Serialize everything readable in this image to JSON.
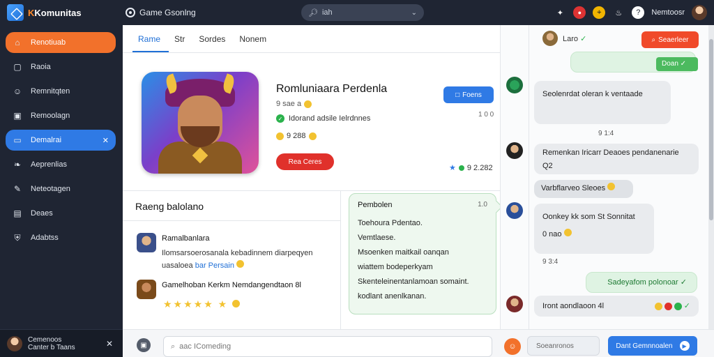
{
  "app": {
    "brand_prefix": "K",
    "brand_name": "Komunitas",
    "title": "Game Gsonlng"
  },
  "search": {
    "placeholder": "iah"
  },
  "top_user": "Nemtoosr",
  "sidebar": {
    "items": [
      {
        "label": "Renotiuab",
        "icon": "home-icon"
      },
      {
        "label": "Raoia",
        "icon": "card-icon"
      },
      {
        "label": "Remnitqten",
        "icon": "users-icon"
      },
      {
        "label": "Remoolagn",
        "icon": "image-icon"
      },
      {
        "label": "Demalrai",
        "icon": "chat-icon"
      },
      {
        "label": "Aeprenlias",
        "icon": "leaf-icon"
      },
      {
        "label": "Neteotagen",
        "icon": "pen-icon"
      },
      {
        "label": "Deaes",
        "icon": "book-icon"
      },
      {
        "label": "Adabtss",
        "icon": "shield-icon"
      }
    ],
    "footer": {
      "line1": "Cemenoos",
      "line2": "Canter b Taans"
    }
  },
  "tabs": [
    "Rame",
    "Str",
    "Sordes",
    "Nonem"
  ],
  "game": {
    "title": "Romluniaara Perdenla",
    "subtitle": "9 sae a",
    "verified": "Idorand adsile Ielrdnnes",
    "coins": "9 288",
    "button": "Rea Ceres",
    "time": "1 0 0",
    "follow": "Foens",
    "rating": "9 2.282"
  },
  "reviews": {
    "header": "Raeng balolano",
    "items": [
      {
        "name": "Ramalbanlara",
        "line1": "Ilomsarsoerosanala kebadinnem diarpeqyen",
        "line2_text": "uasaloea",
        "line2_link": "bar Persain"
      },
      {
        "name": "Gamelhoban",
        "line1": "Kerkm Nemdangendtaon 8l"
      }
    ]
  },
  "note": {
    "title": "Pembolen",
    "time": "1.0",
    "lines": [
      "Toehoura Pdentao.",
      "Vemtlaese.",
      "Msoenken maitkail oanqan",
      "wiattem bodeperkyam",
      "Skenteleinentanlamoan somaint.",
      "kodlant anenlkanan."
    ]
  },
  "chat": {
    "header_name": "Laro",
    "search_button": "Seaerleer",
    "messages": [
      {
        "dir": "out",
        "text": "Doan"
      },
      {
        "dir": "in",
        "text": "Seolenrdat oleran k ventaade",
        "meta": "9 1:4"
      },
      {
        "dir": "in",
        "text": "Remenkan Iricarr Deaoes pendanenarie Q2"
      },
      {
        "dir": "in",
        "text": "Varbflarveo Sleoes"
      },
      {
        "dir": "in",
        "text": "Oonkey kk som St Sonnitat",
        "sub": "0 nao",
        "meta": "9 3:4"
      },
      {
        "dir": "out",
        "text": "Sadeyafom polonoar"
      },
      {
        "dir": "in",
        "text": "Iront aondlaoon 4l"
      }
    ]
  },
  "composer": {
    "placeholder": "aac IComeding",
    "search": "Soeanronos",
    "send": "Dant Gemnnoalen"
  },
  "colors": {
    "accent_blue": "#2f7ae5",
    "accent_orange": "#f2712b",
    "danger_red": "#e0312b",
    "success_green": "#2bb24c",
    "dark_bg": "#1f2533"
  }
}
